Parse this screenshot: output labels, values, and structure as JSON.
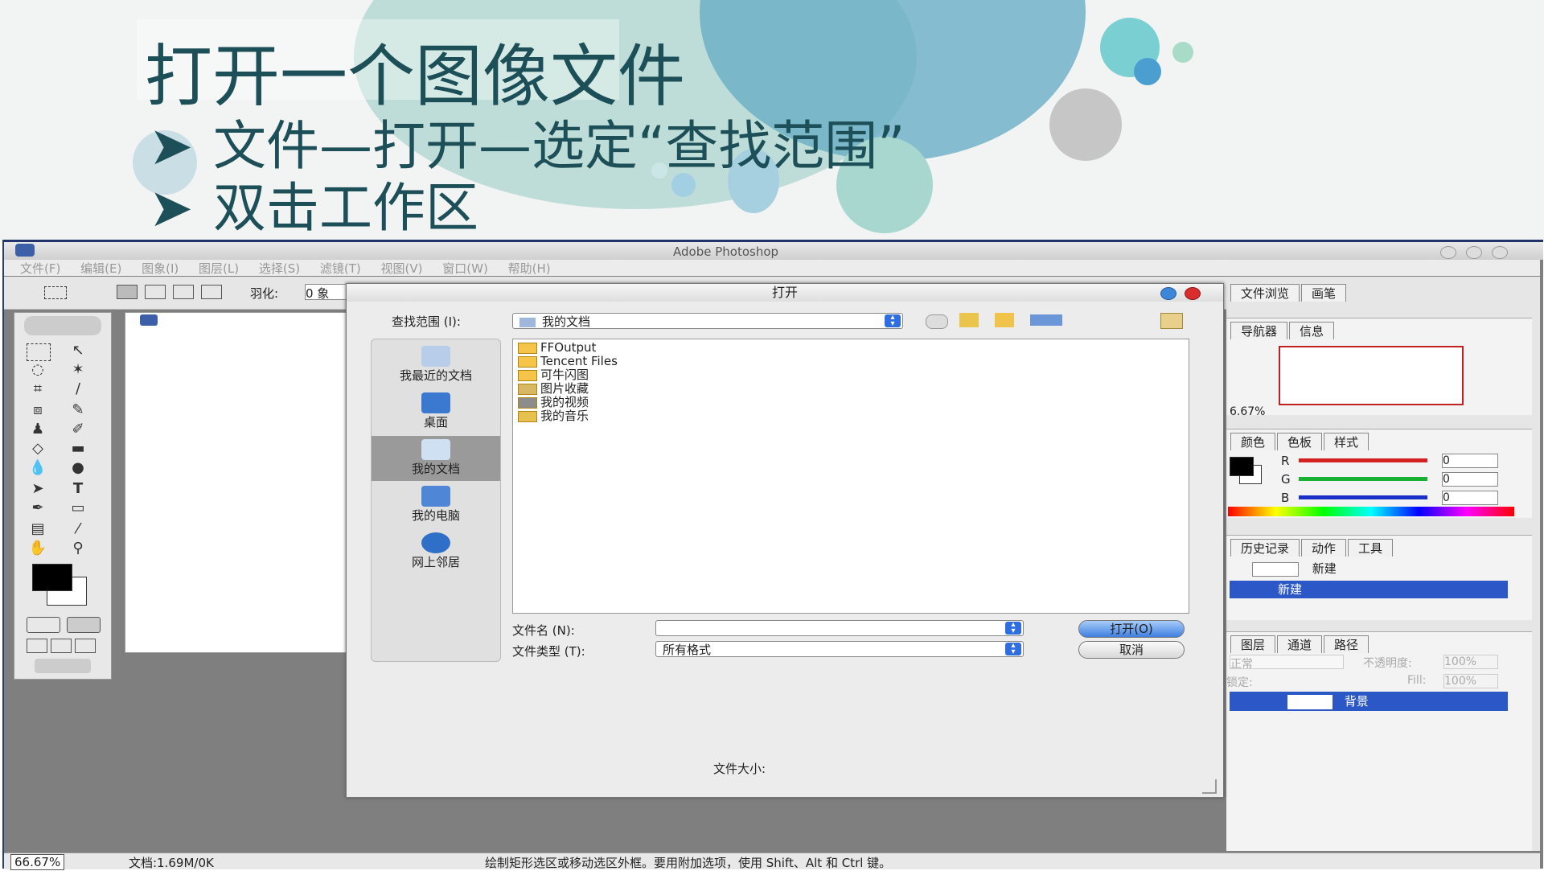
{
  "slide": {
    "title": "打开一个图像文件",
    "bullets": [
      "文件—打开—选定“查找范围”",
      "双击工作区"
    ],
    "bullet_marker": "➤"
  },
  "ps": {
    "window_title": "Adobe Photoshop",
    "menu": [
      "文件(F)",
      "编辑(E)",
      "图象(I)",
      "图层(L)",
      "选择(S)",
      "滤镜(T)",
      "视图(V)",
      "窗口(W)",
      "帮助(H)"
    ],
    "options": {
      "feather_label": "羽化:",
      "feather_value": "0 象"
    },
    "status": {
      "zoom": "66.67%",
      "doc_info": "文档:1.69M/0K",
      "hint": "绘制矩形选区或移动选区外框。要用附加选项，使用 Shift、Alt 和 Ctrl 键。"
    }
  },
  "palettes": {
    "top_tabs": [
      "文件浏览",
      "画笔"
    ],
    "nav_tabs": [
      "导航器",
      "信息"
    ],
    "nav_zoom": "6.67%",
    "color_tabs": [
      "颜色",
      "色板",
      "样式"
    ],
    "color_rows": [
      {
        "label": "R",
        "value": "0",
        "color": "#d42020"
      },
      {
        "label": "G",
        "value": "0",
        "color": "#18b030"
      },
      {
        "label": "B",
        "value": "0",
        "color": "#1a2fc8"
      }
    ],
    "history_tabs": [
      "历史记录",
      "动作",
      "工具"
    ],
    "history_items": [
      "新建",
      "新建"
    ],
    "layer_tabs": [
      "图层",
      "通道",
      "路径"
    ],
    "layer_mode": "正常",
    "opacity_label": "不透明度:",
    "opacity_value": "100%",
    "lock_label": "锁定:",
    "fill_label": "Fill:",
    "fill_value": "100%",
    "layer_name": "背景"
  },
  "dialog": {
    "title": "打开",
    "lookin_label": "查找范围 (I):",
    "lookin_value": "我的文档",
    "places": [
      "我最近的文档",
      "桌面",
      "我的文档",
      "我的电脑",
      "网上邻居"
    ],
    "selected_place": "我的文档",
    "files": [
      "FFOutput",
      "Tencent Files",
      "可牛闪图",
      "图片收藏",
      "我的视频",
      "我的音乐"
    ],
    "filename_label": "文件名 (N):",
    "filename_value": "",
    "filetype_label": "文件类型 (T):",
    "filetype_value": "所有格式",
    "open_button": "打开(O)",
    "cancel_button": "取消",
    "filesize_label": "文件大小:"
  }
}
